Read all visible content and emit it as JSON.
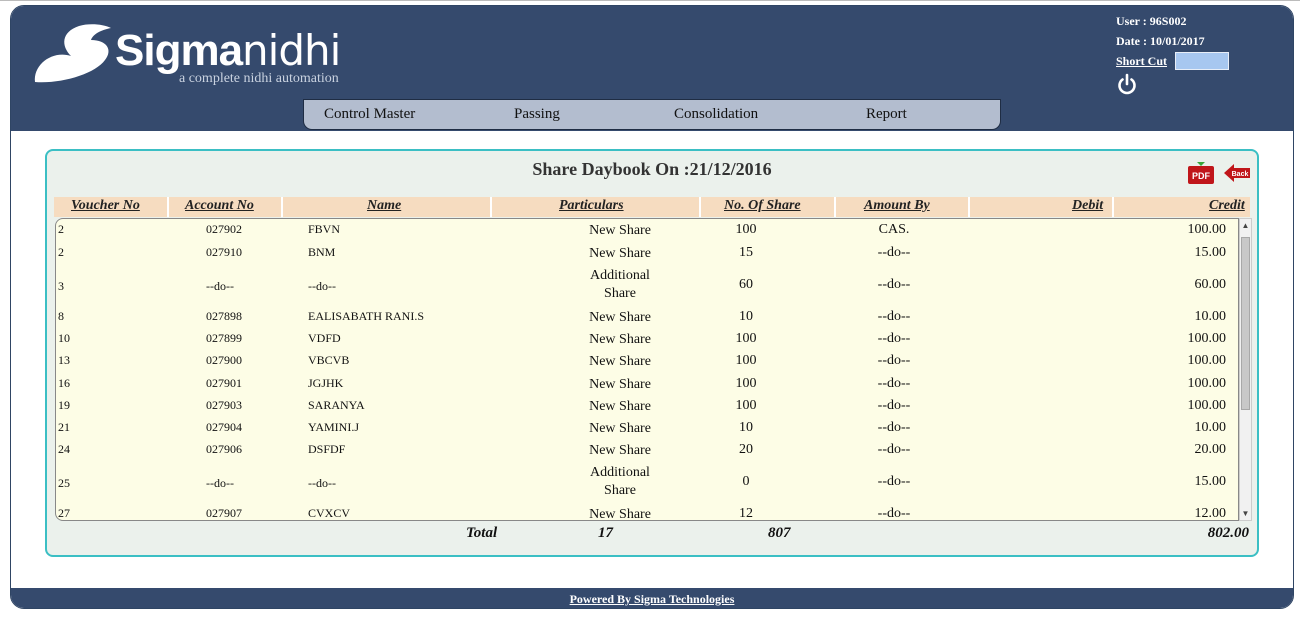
{
  "app": {
    "logo_bold": "Sigma",
    "logo_light": "nidhi",
    "tagline": "a complete nidhi automation"
  },
  "user": {
    "user_label": "User : 96S002",
    "date_label": "Date : 10/01/2017",
    "shortcut_label": "Short Cut",
    "shortcut_value": ""
  },
  "nav": {
    "items": [
      "Control Master",
      "Passing",
      "Consolidation",
      "Report"
    ]
  },
  "panel": {
    "title": "Share Daybook On :21/12/2016",
    "pdf_label": "PDF",
    "back_label": "Back"
  },
  "table": {
    "headers": [
      "Voucher No",
      "Account No",
      "Name",
      "Particulars",
      "No. Of Share",
      "Amount By",
      "Debit",
      "Credit"
    ],
    "rows": [
      {
        "voucher": "2",
        "account": "027902",
        "name": "FBVN",
        "particulars": "New Share",
        "shares": "100",
        "amount_by": "CAS.",
        "debit": "",
        "credit": "100.00"
      },
      {
        "voucher": "2",
        "account": "027910",
        "name": "BNM",
        "particulars": "New Share",
        "shares": "15",
        "amount_by": "--do--",
        "debit": "",
        "credit": "15.00"
      },
      {
        "voucher": "3",
        "account": "--do--",
        "name": "--do--",
        "particulars": "Additional Share",
        "shares": "60",
        "amount_by": "--do--",
        "debit": "",
        "credit": "60.00"
      },
      {
        "voucher": "8",
        "account": "027898",
        "name": "EALISABATH RANI.S",
        "particulars": "New Share",
        "shares": "10",
        "amount_by": "--do--",
        "debit": "",
        "credit": "10.00"
      },
      {
        "voucher": "10",
        "account": "027899",
        "name": "VDFD",
        "particulars": "New Share",
        "shares": "100",
        "amount_by": "--do--",
        "debit": "",
        "credit": "100.00"
      },
      {
        "voucher": "13",
        "account": "027900",
        "name": "VBCVB",
        "particulars": "New Share",
        "shares": "100",
        "amount_by": "--do--",
        "debit": "",
        "credit": "100.00"
      },
      {
        "voucher": "16",
        "account": "027901",
        "name": "JGJHK",
        "particulars": "New Share",
        "shares": "100",
        "amount_by": "--do--",
        "debit": "",
        "credit": "100.00"
      },
      {
        "voucher": "19",
        "account": "027903",
        "name": "SARANYA",
        "particulars": "New Share",
        "shares": "100",
        "amount_by": "--do--",
        "debit": "",
        "credit": "100.00"
      },
      {
        "voucher": "21",
        "account": "027904",
        "name": "YAMINI.J",
        "particulars": "New Share",
        "shares": "10",
        "amount_by": "--do--",
        "debit": "",
        "credit": "10.00"
      },
      {
        "voucher": "24",
        "account": "027906",
        "name": "DSFDF",
        "particulars": "New Share",
        "shares": "20",
        "amount_by": "--do--",
        "debit": "",
        "credit": "20.00"
      },
      {
        "voucher": "25",
        "account": "--do--",
        "name": "--do--",
        "particulars": "Additional Share",
        "shares": "0",
        "amount_by": "--do--",
        "debit": "",
        "credit": "15.00"
      },
      {
        "voucher": "27",
        "account": "027907",
        "name": "CVXCV",
        "particulars": "New Share",
        "shares": "12",
        "amount_by": "--do--",
        "debit": "",
        "credit": "12.00"
      }
    ],
    "total": {
      "label": "Total",
      "count": "17",
      "shares": "807",
      "credit": "802.00"
    }
  },
  "footer": {
    "powered_by": "Powered By Sigma Technologies"
  },
  "icons": {
    "logo": "sigma-swoosh-icon",
    "power": "power-icon",
    "pdf": "pdf-icon",
    "back": "back-arrow-icon"
  },
  "colors": {
    "header_bg": "#354a6d",
    "panel_border": "#3bbfc4",
    "table_header_bg": "#f6dcc0",
    "table_body_bg": "#fdfde6"
  }
}
